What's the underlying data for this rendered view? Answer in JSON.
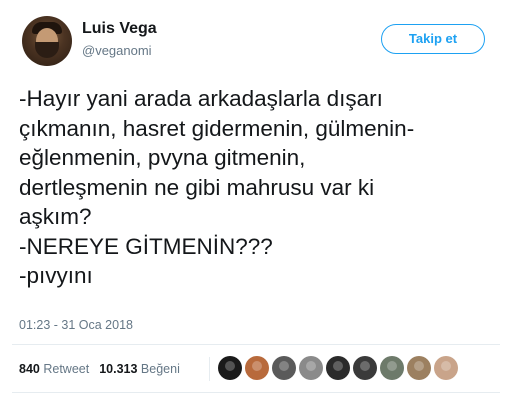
{
  "user": {
    "display_name": "Luis Vega",
    "handle": "@veganomi"
  },
  "follow_button": {
    "label": "Takip et"
  },
  "tweet": {
    "lines": [
      "-Hayır yani arada arkadaşlarla dışarı",
      "çıkmanın, hasret gidermenin, gülmenin-",
      "eğlenmenin, pvyna gitmenin,",
      "dertleşmenin ne gibi mahrusu var ki",
      "aşkım?",
      "-NEREYE GİTMENİN???",
      "-pıvyını"
    ],
    "timestamp": "01:23 - 31 Oca 2018"
  },
  "stats": {
    "retweet_count": "840",
    "retweet_label": "Retweet",
    "like_count": "10.313",
    "like_label": "Beğeni"
  },
  "likers": [
    {
      "name": "liker-avatar-1",
      "color": "#1a1a1a"
    },
    {
      "name": "liker-avatar-2",
      "color": "#b86a3c"
    },
    {
      "name": "liker-avatar-3",
      "color": "#5a5a5a"
    },
    {
      "name": "liker-avatar-4",
      "color": "#8a8a8a"
    },
    {
      "name": "liker-avatar-5",
      "color": "#2b2b2b"
    },
    {
      "name": "liker-avatar-6",
      "color": "#3a3a3a"
    },
    {
      "name": "liker-avatar-7",
      "color": "#6d7a6a"
    },
    {
      "name": "liker-avatar-8",
      "color": "#9c8060"
    },
    {
      "name": "liker-avatar-9",
      "color": "#c9a48a"
    }
  ],
  "colors": {
    "accent": "#1da1f2",
    "text": "#14171a",
    "muted": "#657786",
    "divider": "#e6ecf0"
  }
}
